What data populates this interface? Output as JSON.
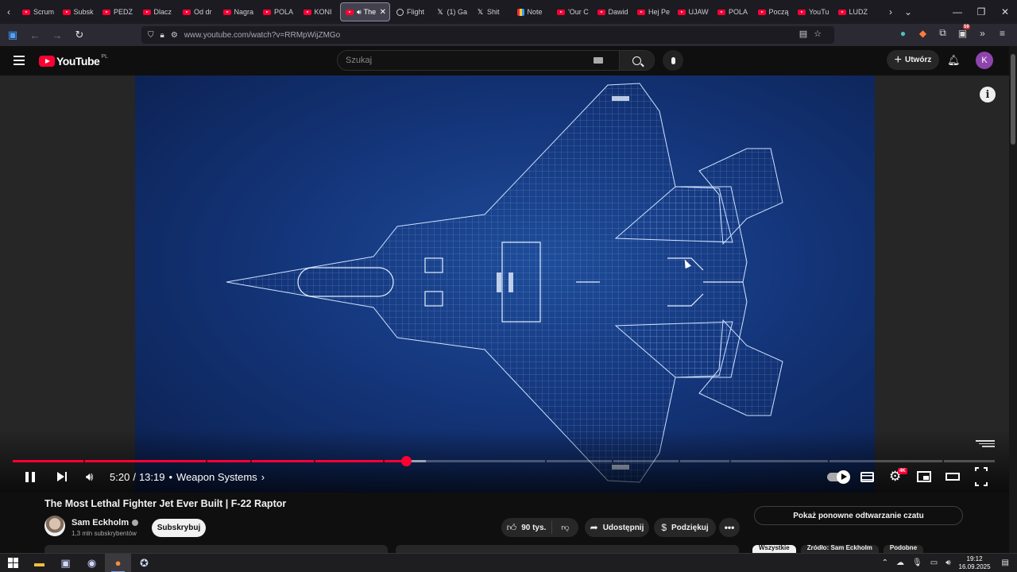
{
  "browser": {
    "tabs": [
      {
        "label": "Scrum",
        "icon": "youtube-icon"
      },
      {
        "label": "Subsk",
        "icon": "youtube-icon"
      },
      {
        "label": "PEDZ",
        "icon": "youtube-icon"
      },
      {
        "label": "Dlacz",
        "icon": "youtube-icon"
      },
      {
        "label": "Od dr",
        "icon": "youtube-icon"
      },
      {
        "label": "Nagra",
        "icon": "youtube-icon"
      },
      {
        "label": "POLA",
        "icon": "youtube-icon"
      },
      {
        "label": "KONI",
        "icon": "youtube-icon"
      },
      {
        "label": "The",
        "icon": "youtube-icon",
        "active": true
      },
      {
        "label": "Flight",
        "icon": "globe-icon"
      },
      {
        "label": "(1) Ga",
        "icon": "x-icon"
      },
      {
        "label": "Shit",
        "icon": "x-icon"
      },
      {
        "label": "Note",
        "icon": "notes-icon"
      },
      {
        "label": "'Our C",
        "icon": "youtube-icon"
      },
      {
        "label": "Dawid",
        "icon": "youtube-icon"
      },
      {
        "label": "Hej Pe",
        "icon": "youtube-icon"
      },
      {
        "label": "UJAW",
        "icon": "youtube-icon"
      },
      {
        "label": "POLA",
        "icon": "youtube-icon"
      },
      {
        "label": "Począ",
        "icon": "youtube-icon"
      },
      {
        "label": "YouTu",
        "icon": "youtube-icon"
      },
      {
        "label": "LUDZ",
        "icon": "youtube-icon"
      }
    ],
    "url": "www.youtube.com/watch?v=RRMpWijZMGo",
    "extension_badge": "59"
  },
  "youtube": {
    "logo_text": "YouTube",
    "country_code": "PL",
    "search_placeholder": "Szukaj",
    "create_label": "Utwórz",
    "avatar_letter": "K"
  },
  "player": {
    "current_time": "5:20",
    "duration": "13:19",
    "chapter": "Weapon Systems",
    "progress_fraction": 0.4005,
    "buffered_fraction": 0.4205,
    "chapter_breaks": [
      0.072,
      0.197,
      0.242,
      0.307,
      0.377,
      0.542,
      0.61,
      0.678,
      0.73,
      0.83,
      0.947
    ],
    "quality_badge": "4K",
    "accent_color": "#ff0033"
  },
  "video": {
    "title": "The Most Lethal Fighter Jet Ever Built | F-22 Raptor",
    "channel_name": "Sam Eckholm",
    "channel_subscribers": "1,3 mln subskrybentów",
    "subscribe_label": "Subskrybuj",
    "likes": "90 tys.",
    "share_label": "Udostępnij",
    "thanks_label": "Podziękuj",
    "chat_replay_label": "Pokaż ponowne odtwarzanie czatu"
  },
  "chips": [
    {
      "label": "Wszystkie",
      "selected": true
    },
    {
      "label": "Źródło: Sam Eckholm"
    },
    {
      "label": "Podobne"
    }
  ],
  "taskbar": {
    "time": "19:12",
    "date": "16.09.2025"
  }
}
